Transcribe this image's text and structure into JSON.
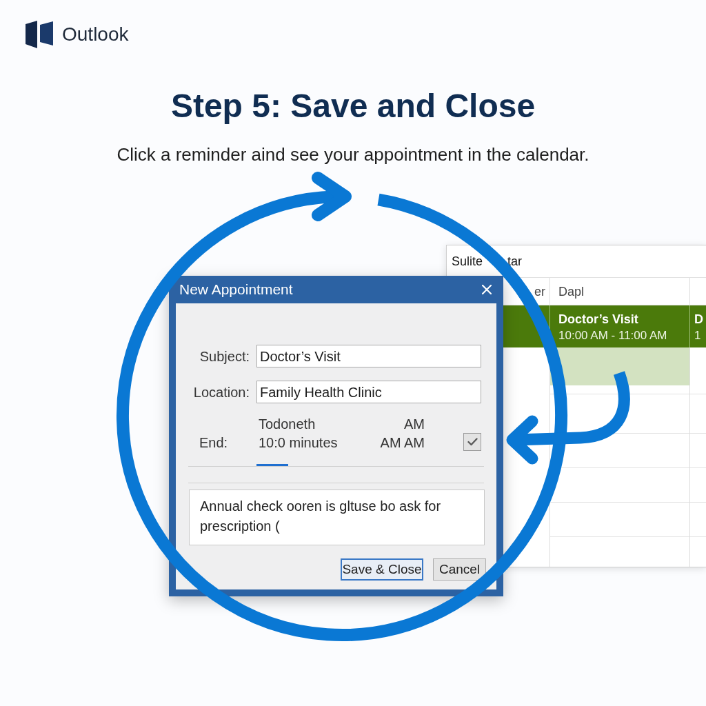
{
  "logo": {
    "name": "Outlook"
  },
  "heading": "Step 5: Save and Close",
  "subheading": "Click a reminder aind see your appointment in the calendar.",
  "calendar": {
    "title": [
      "Sulite",
      "tar"
    ],
    "columns": [
      {
        "label": "er"
      },
      {
        "label": "Dapl"
      }
    ],
    "events": [
      {
        "title": "Doctor’s Visit",
        "time": "10:00 AM - 11:00 AM"
      },
      {
        "title": "D",
        "time": "1"
      }
    ]
  },
  "dialog": {
    "title": "New Appointment",
    "fields": [
      {
        "label": "Subject:",
        "value": "Doctor’s Visit"
      },
      {
        "label": "Location:",
        "value": "Family Health Clinic"
      }
    ],
    "end": {
      "label": "End:",
      "lines": [
        {
          "left": "Todoneth",
          "right": "AM"
        },
        {
          "left": "10:0 minutes",
          "right": "AM AM"
        }
      ],
      "checked": true
    },
    "notes": "Annual check ooren is gltuse bo ask for prescription (",
    "buttons": [
      {
        "label": "Save & Close",
        "default": true
      },
      {
        "label": "Cancel",
        "default": false
      }
    ]
  }
}
